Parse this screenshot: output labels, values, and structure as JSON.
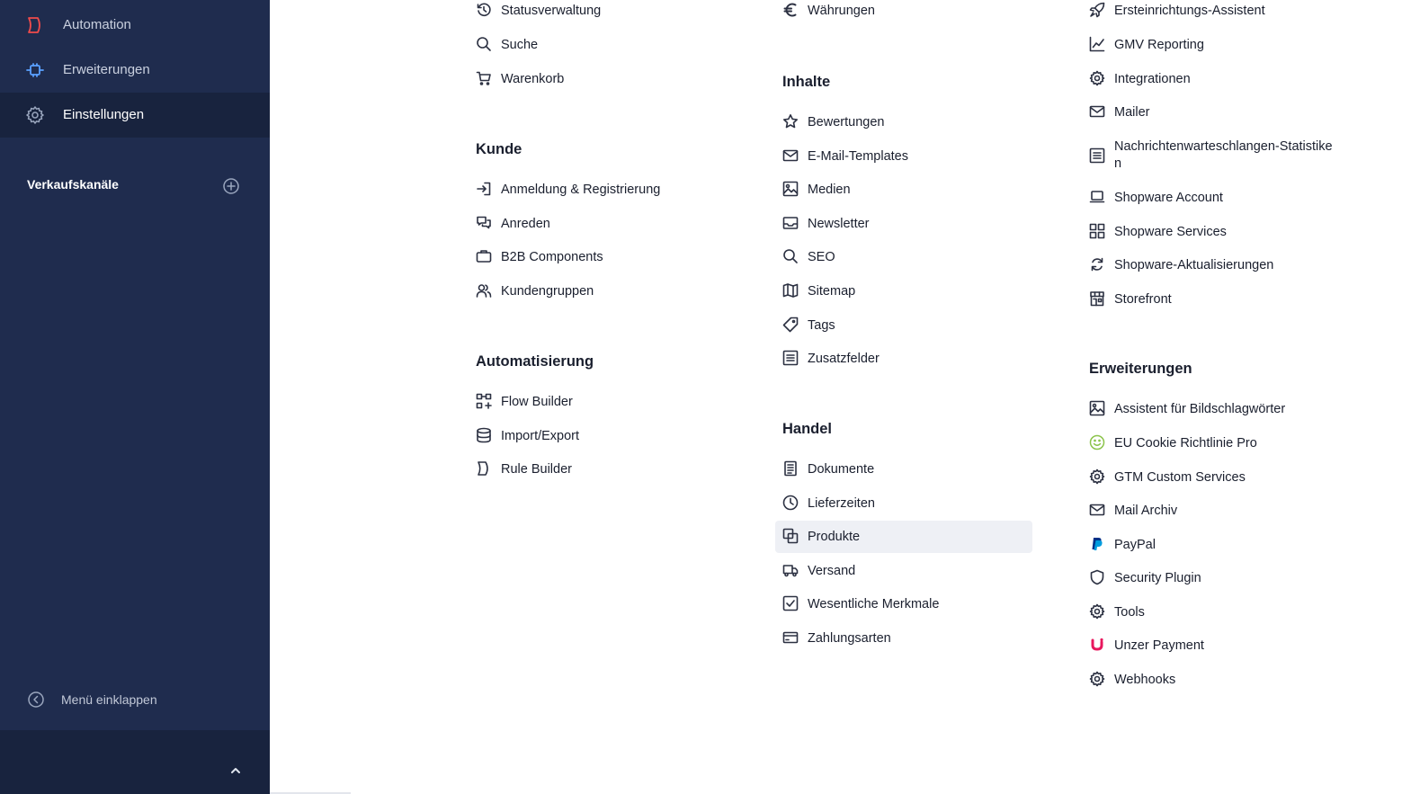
{
  "sidebar": {
    "nav": [
      {
        "label": "Automation",
        "icon": "automation-icon",
        "active": false
      },
      {
        "label": "Erweiterungen",
        "icon": "plug-icon",
        "active": false
      },
      {
        "label": "Einstellungen",
        "icon": "gear-icon",
        "active": true
      }
    ],
    "channels_title": "Verkaufskanäle",
    "collapse_label": "Menü einklappen",
    "colors": {
      "background": "#1f2c4e",
      "active": "#18233e",
      "automation_icon": "#ef4b4b",
      "plug_icon": "#5aa0ff"
    }
  },
  "columns": {
    "col1": {
      "top_items": [
        {
          "label": "Statusverwaltung",
          "icon": "history-icon"
        },
        {
          "label": "Suche",
          "icon": "search-icon"
        },
        {
          "label": "Warenkorb",
          "icon": "cart-icon"
        }
      ],
      "kunde": {
        "title": "Kunde",
        "items": [
          {
            "label": "Anmeldung & Registrierung",
            "icon": "sign-in-icon"
          },
          {
            "label": "Anreden",
            "icon": "speech-bubbles-icon"
          },
          {
            "label": "B2B Components",
            "icon": "briefcase-icon"
          },
          {
            "label": "Kundengruppen",
            "icon": "users-icon"
          }
        ]
      },
      "automatisierung": {
        "title": "Automatisierung",
        "items": [
          {
            "label": "Flow Builder",
            "icon": "flow-icon"
          },
          {
            "label": "Import/Export",
            "icon": "database-icon"
          },
          {
            "label": "Rule Builder",
            "icon": "rule-icon"
          }
        ]
      }
    },
    "col2": {
      "top_items": [
        {
          "label": "Währungen",
          "icon": "euro-icon"
        }
      ],
      "inhalte": {
        "title": "Inhalte",
        "items": [
          {
            "label": "Bewertungen",
            "icon": "star-icon"
          },
          {
            "label": "E-Mail-Templates",
            "icon": "envelope-icon"
          },
          {
            "label": "Medien",
            "icon": "image-icon"
          },
          {
            "label": "Newsletter",
            "icon": "inbox-icon"
          },
          {
            "label": "SEO",
            "icon": "search-icon"
          },
          {
            "label": "Sitemap",
            "icon": "map-icon"
          },
          {
            "label": "Tags",
            "icon": "tag-icon"
          },
          {
            "label": "Zusatzfelder",
            "icon": "list-icon"
          }
        ]
      },
      "handel": {
        "title": "Handel",
        "items": [
          {
            "label": "Dokumente",
            "icon": "document-icon"
          },
          {
            "label": "Lieferzeiten",
            "icon": "clock-icon"
          },
          {
            "label": "Produkte",
            "icon": "products-icon",
            "highlighted": true
          },
          {
            "label": "Versand",
            "icon": "truck-icon"
          },
          {
            "label": "Wesentliche Merkmale",
            "icon": "checkbox-icon"
          },
          {
            "label": "Zahlungsarten",
            "icon": "credit-card-icon"
          }
        ]
      }
    },
    "col3": {
      "top_items": [
        {
          "label": "Ersteinrichtungs-Assistent",
          "icon": "rocket-icon"
        },
        {
          "label": "GMV Reporting",
          "icon": "chart-line-icon"
        },
        {
          "label": "Integrationen",
          "icon": "gear-icon"
        },
        {
          "label": "Mailer",
          "icon": "envelope-icon"
        },
        {
          "label": "Nachrichtenwarteschlangen-Statistiken",
          "icon": "list-icon"
        },
        {
          "label": "Shopware Account",
          "icon": "laptop-icon"
        },
        {
          "label": "Shopware Services",
          "icon": "grid-icon"
        },
        {
          "label": "Shopware-Aktualisierungen",
          "icon": "refresh-icon"
        },
        {
          "label": "Storefront",
          "icon": "storefront-icon"
        }
      ],
      "erweiterungen": {
        "title": "Erweiterungen",
        "items": [
          {
            "label": "Assistent für Bildschlagwörter",
            "icon": "image-icon"
          },
          {
            "label": "EU Cookie Richtlinie Pro",
            "icon": "smiley-icon"
          },
          {
            "label": "GTM Custom Services",
            "icon": "gear-icon"
          },
          {
            "label": "Mail Archiv",
            "icon": "envelope-icon"
          },
          {
            "label": "PayPal",
            "icon": "paypal-icon"
          },
          {
            "label": "Security Plugin",
            "icon": "shield-icon"
          },
          {
            "label": "Tools",
            "icon": "gear-icon"
          },
          {
            "label": "Unzer Payment",
            "icon": "unzer-icon"
          },
          {
            "label": "Webhooks",
            "icon": "gear-icon"
          }
        ]
      }
    }
  },
  "colors": {
    "highlight": "#eef0f5",
    "text": "#1a1f2e",
    "smiley": "#8bc34a",
    "paypal_dark": "#003087",
    "paypal_light": "#009cde",
    "unzer": "#e8175d"
  }
}
